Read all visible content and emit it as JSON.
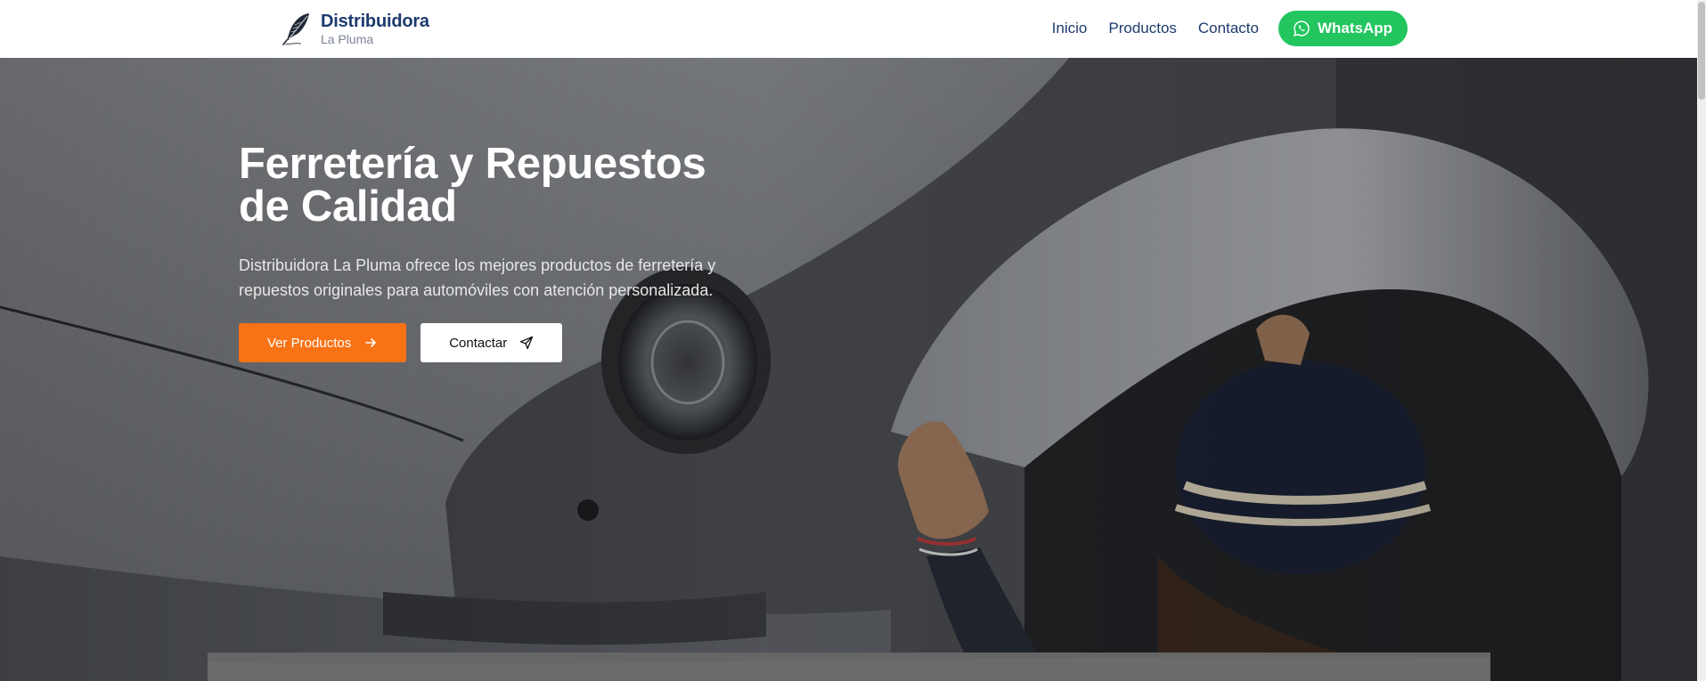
{
  "brand": {
    "title": "Distribuidora",
    "subtitle": "La Pluma",
    "icon": "feather-icon"
  },
  "nav": {
    "items": [
      {
        "label": "Inicio"
      },
      {
        "label": "Productos"
      },
      {
        "label": "Contacto"
      }
    ],
    "whatsapp": {
      "label": "WhatsApp",
      "icon": "whatsapp-icon"
    }
  },
  "hero": {
    "title_line1": "Ferretería y Repuestos",
    "title_line2": "de Calidad",
    "description": "Distribuidora La Pluma ofrece los mejores productos de ferretería y repuestos originales para automóviles con atención personalizada.",
    "primary_button": {
      "label": "Ver Productos",
      "icon": "arrow-right-icon"
    },
    "secondary_button": {
      "label": "Contactar",
      "icon": "send-icon"
    }
  },
  "colors": {
    "brand_navy": "#1e3a6e",
    "whatsapp_green": "#22c55e",
    "primary_orange": "#f97316"
  }
}
